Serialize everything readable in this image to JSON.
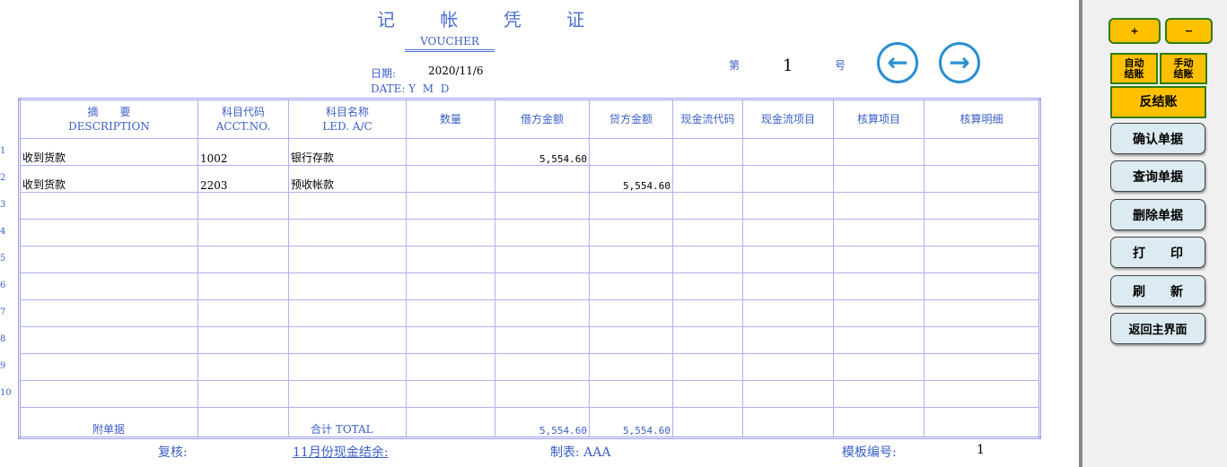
{
  "title": "记 帐 凭 证",
  "subtitle": "VOUCHER",
  "date_label": "日期:",
  "date_value": "2020/11/6",
  "date_en": "DATE: Y  M  D",
  "number_prefix": "第",
  "number_value": "1",
  "number_suffix": "号",
  "headers": [
    [
      "摘　　要",
      "DESCRIPTION"
    ],
    [
      "科目代码",
      "ACCT.NO."
    ],
    [
      "科目名称",
      "LED. A/C"
    ],
    [
      "数量",
      ""
    ],
    [
      "借方金额",
      ""
    ],
    [
      "贷方金额",
      ""
    ],
    [
      "现金流代码",
      ""
    ],
    [
      "现金流项目",
      ""
    ],
    [
      "核算项目",
      ""
    ],
    [
      "核算明细",
      ""
    ]
  ],
  "rows": [
    {
      "no": "1",
      "desc": "收到货款",
      "code": "1002",
      "name": "银行存款",
      "qty": "",
      "debit": "5,554.60",
      "credit": "",
      "cf_code": "",
      "cf_item": "",
      "acct_item": "",
      "acct_detail": ""
    },
    {
      "no": "2",
      "desc": "收到货款",
      "code": "2203",
      "name": "预收帐款",
      "qty": "",
      "debit": "",
      "credit": "5,554.60",
      "cf_code": "",
      "cf_item": "",
      "acct_item": "",
      "acct_detail": ""
    },
    {
      "no": "3"
    },
    {
      "no": "4"
    },
    {
      "no": "5"
    },
    {
      "no": "6"
    },
    {
      "no": "7"
    },
    {
      "no": "8"
    },
    {
      "no": "9"
    },
    {
      "no": "10"
    }
  ],
  "total": {
    "attach_label": "附单据",
    "total_label": "合计  TOTAL",
    "debit": "5,554.60",
    "credit": "5,554.60"
  },
  "footer": {
    "review": "复核:",
    "cash_balance": "11月份现金结余:",
    "maker": "制表: AAA",
    "template_label": "模板编号:",
    "template_value": "1"
  },
  "panel": {
    "plus": "+",
    "minus": "−",
    "auto_close": "自动结账",
    "manual_close": "手动结账",
    "reverse_close": "反结账",
    "buttons": [
      "确认单据",
      "查询单据",
      "删除单据",
      "打　　印",
      "刷　　新",
      "返回主界面"
    ]
  }
}
